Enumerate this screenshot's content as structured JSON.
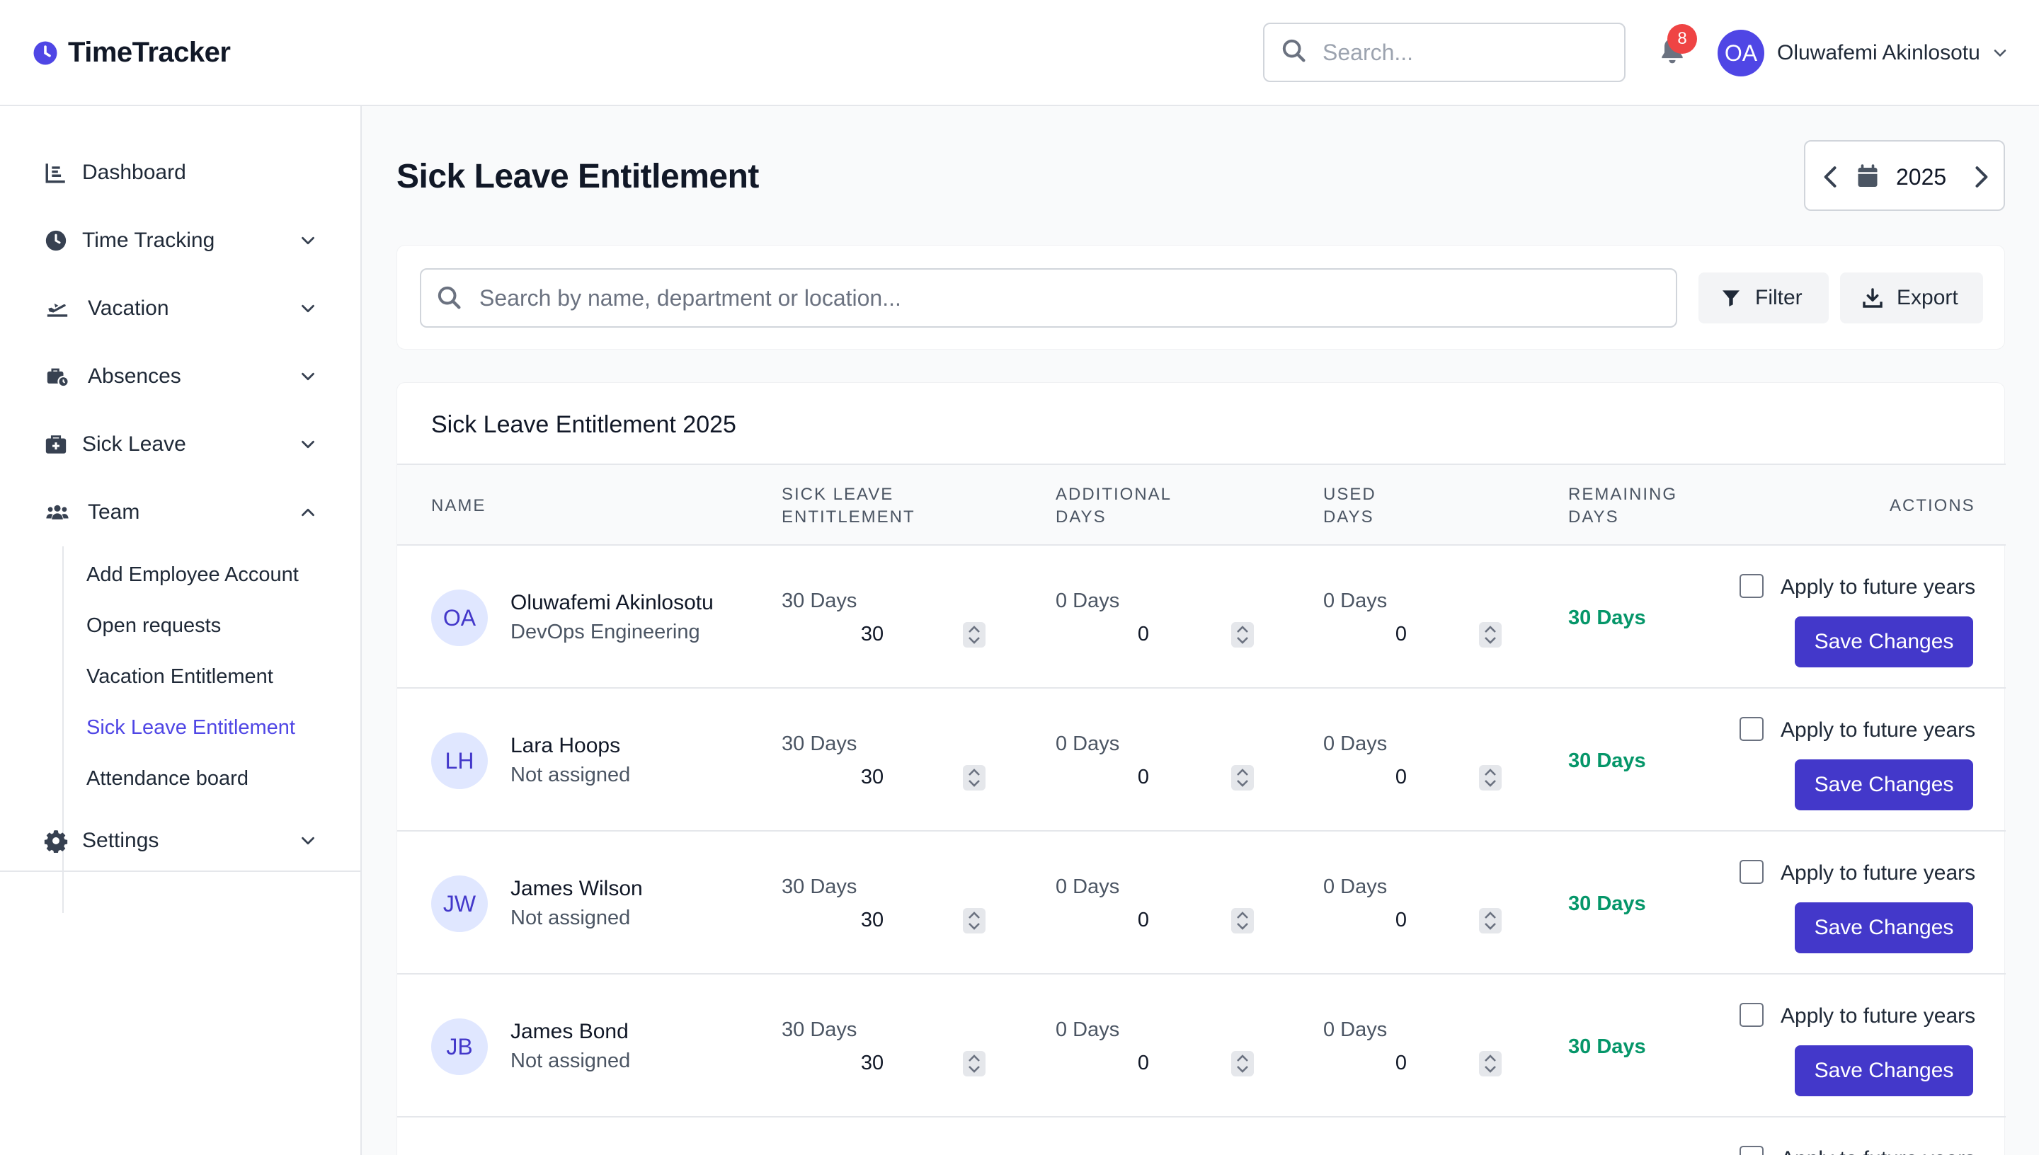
{
  "header": {
    "app_name": "TimeTracker",
    "search_placeholder": "Search...",
    "notification_count": "8",
    "user_initials": "OA",
    "user_name": "Oluwafemi Akinlosotu"
  },
  "sidebar": {
    "items": [
      {
        "label": "Dashboard",
        "icon": "chart-icon"
      },
      {
        "label": "Time Tracking",
        "icon": "clock-icon"
      },
      {
        "label": "Vacation",
        "icon": "plane-icon"
      },
      {
        "label": "Absences",
        "icon": "briefcase-clock-icon"
      },
      {
        "label": "Sick Leave",
        "icon": "medical-kit-icon"
      },
      {
        "label": "Team",
        "icon": "users-icon"
      },
      {
        "label": "Settings",
        "icon": "gear-icon"
      }
    ],
    "team_sub": [
      "Add Employee Account",
      "Open requests",
      "Vacation Entitlement",
      "Sick Leave Entitlement",
      "Attendance board"
    ],
    "active_sub": "Sick Leave Entitlement"
  },
  "page": {
    "title": "Sick Leave Entitlement",
    "year": "2025",
    "search_placeholder": "Search by name, department or location...",
    "filter_label": "Filter",
    "export_label": "Export"
  },
  "table": {
    "card_title": "Sick Leave Entitlement 2025",
    "headers": {
      "name": "NAME",
      "entitlement": [
        "SICK LEAVE",
        "ENTITLEMENT"
      ],
      "additional": [
        "ADDITIONAL",
        "DAYS"
      ],
      "used": [
        "USED",
        "DAYS"
      ],
      "remaining": [
        "REMAINING",
        "DAYS"
      ],
      "actions": "ACTIONS"
    },
    "rows": [
      {
        "initials": "OA",
        "name": "Oluwafemi Akinlosotu",
        "dept": "DevOps Engineering",
        "ent_label": "30 Days",
        "ent_value": "30",
        "add_label": "0 Days",
        "add_value": "0",
        "used_label": "0 Days",
        "used_value": "0",
        "remaining": "30 Days",
        "apply_label": "Apply to future years",
        "save_label": "Save Changes"
      },
      {
        "initials": "LH",
        "name": "Lara Hoops",
        "dept": "Not assigned",
        "ent_label": "30 Days",
        "ent_value": "30",
        "add_label": "0 Days",
        "add_value": "0",
        "used_label": "0 Days",
        "used_value": "0",
        "remaining": "30 Days",
        "apply_label": "Apply to future years",
        "save_label": "Save Changes"
      },
      {
        "initials": "JW",
        "name": "James Wilson",
        "dept": "Not assigned",
        "ent_label": "30 Days",
        "ent_value": "30",
        "add_label": "0 Days",
        "add_value": "0",
        "used_label": "0 Days",
        "used_value": "0",
        "remaining": "30 Days",
        "apply_label": "Apply to future years",
        "save_label": "Save Changes"
      },
      {
        "initials": "JB",
        "name": "James Bond",
        "dept": "Not assigned",
        "ent_label": "30 Days",
        "ent_value": "30",
        "add_label": "0 Days",
        "add_value": "0",
        "used_label": "0 Days",
        "used_value": "0",
        "remaining": "30 Days",
        "apply_label": "Apply to future years",
        "save_label": "Save Changes"
      }
    ],
    "partial_row": {
      "apply_label": "Apply to future years"
    }
  },
  "colors": {
    "accent": "#4f46e5",
    "button": "#4338ca",
    "remaining": "#059669",
    "badge": "#ef4444"
  }
}
